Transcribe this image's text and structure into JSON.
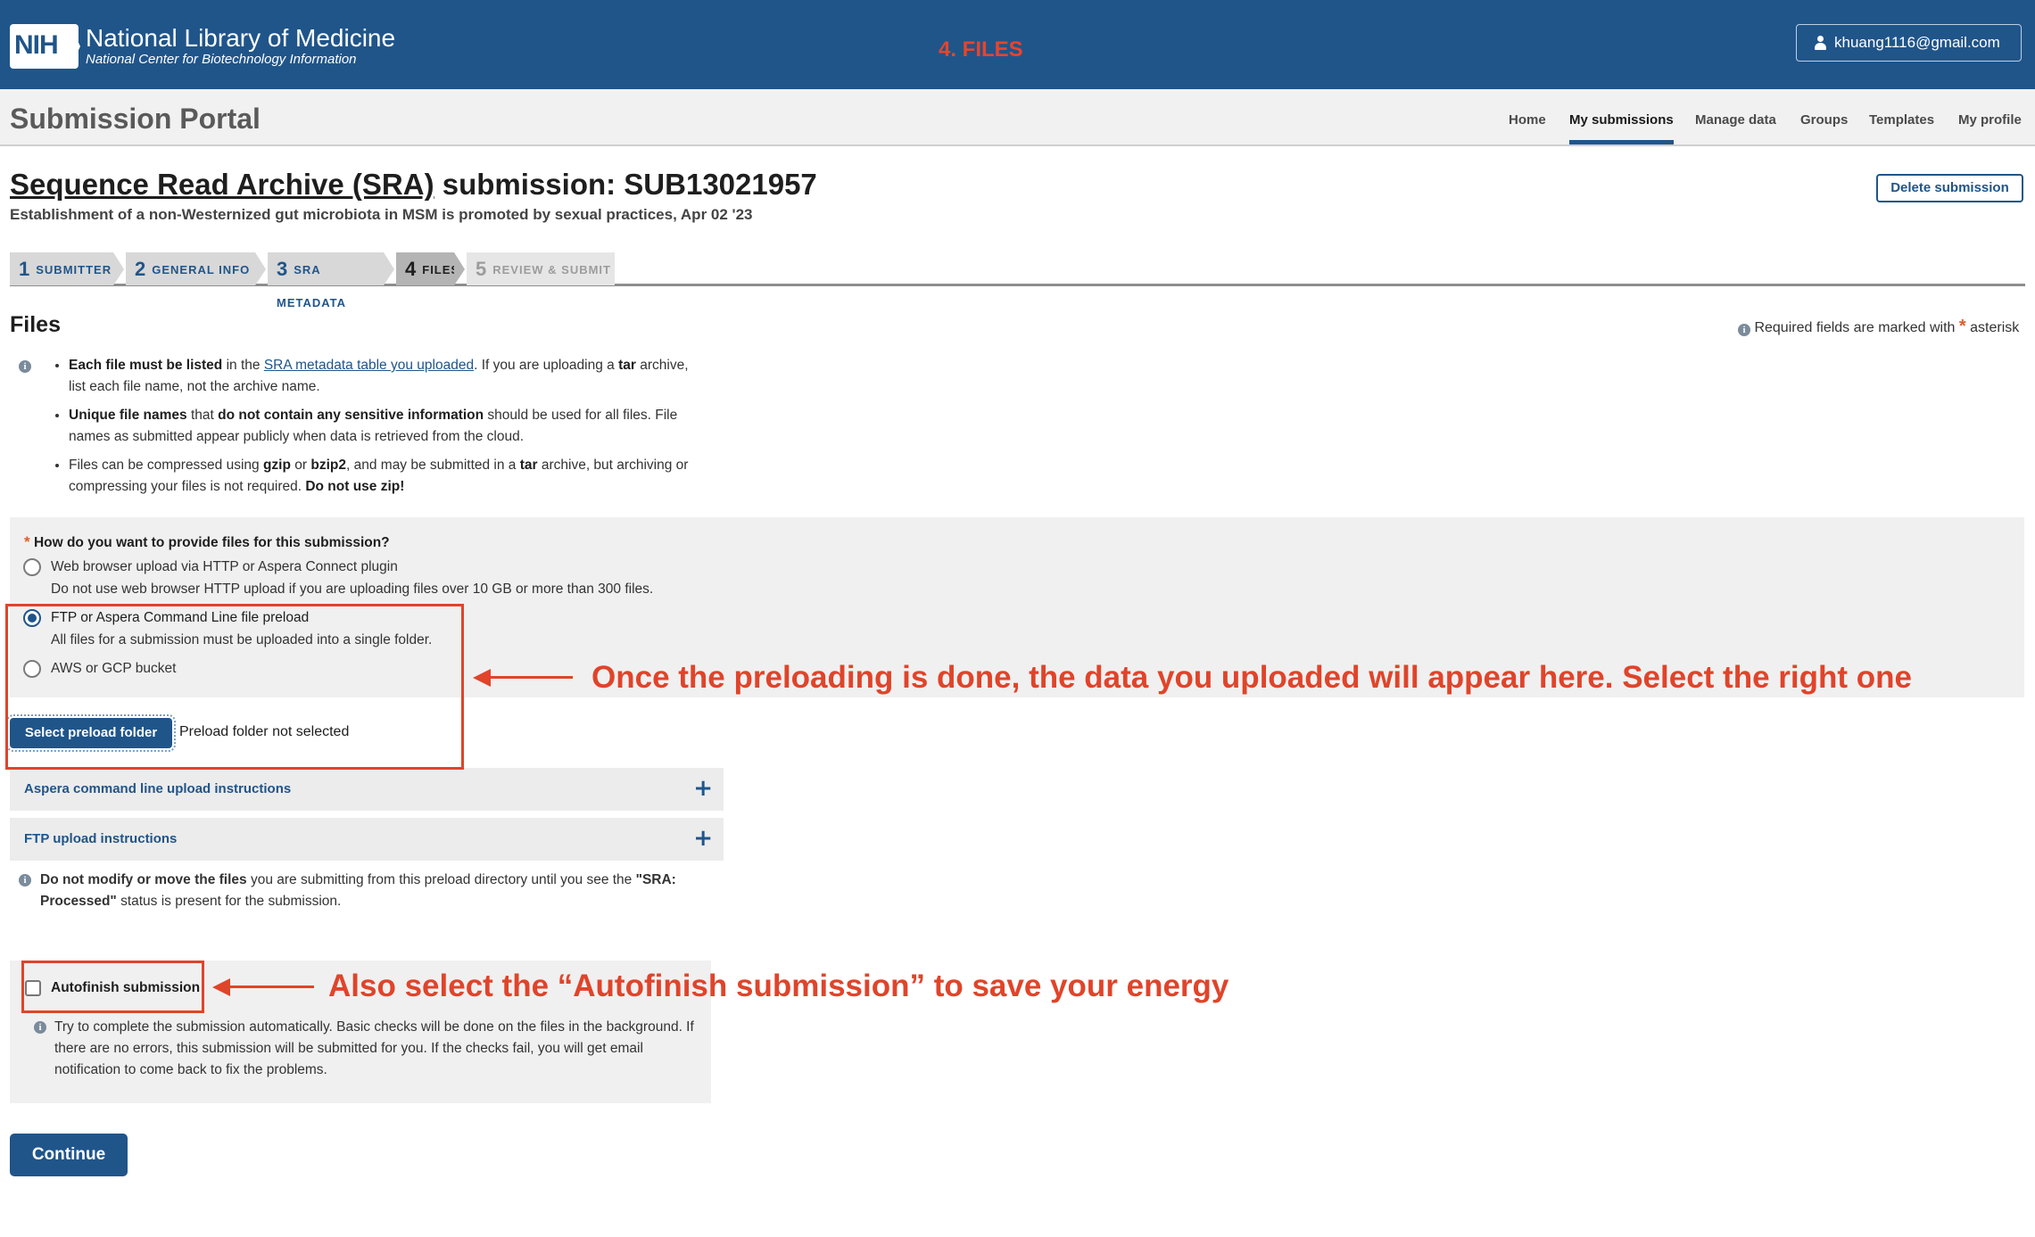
{
  "header": {
    "logo_text": "NIH",
    "org_name": "National Library of Medicine",
    "org_sub": "National Center for Biotechnology Information",
    "step_title": "4. FILES",
    "account_email": "khuang1116@gmail.com"
  },
  "nav": {
    "portal_title": "Submission Portal",
    "items": [
      "Home",
      "My submissions",
      "Manage data",
      "Groups",
      "Templates",
      "My profile"
    ],
    "active": "My submissions"
  },
  "submission": {
    "title_link": "Sequence Read Archive (SRA)",
    "title_rest": " submission: SUB13021957",
    "subtitle": "Establishment of a non-Westernized gut microbiota in MSM is promoted by sexual practices, Apr 02 '23",
    "delete_label": "Delete submission"
  },
  "steps": [
    {
      "num": "1",
      "label": "SUBMITTER"
    },
    {
      "num": "2",
      "label": "GENERAL INFO"
    },
    {
      "num": "3",
      "label": "SRA METADATA"
    },
    {
      "num": "4",
      "label": "FILES"
    },
    {
      "num": "5",
      "label": "REVIEW & SUBMIT"
    }
  ],
  "files": {
    "heading": "Files",
    "required_note_prefix": "Required fields are marked with",
    "required_note_suffix": "asterisk",
    "bullets": {
      "b1_bold": "Each file must be listed",
      "b1_text1": " in the ",
      "b1_link": "SRA metadata table you uploaded",
      "b1_text2": ". If you are uploading a ",
      "b1_bold2": "tar",
      "b1_text3": " archive, list each file name, not the archive name.",
      "b2_bold": "Unique file names",
      "b2_text1": " that ",
      "b2_bold2": "do not contain any sensitive information",
      "b2_text2": " should be used for all files. File names as submitted appear publicly when data is retrieved from the cloud.",
      "b3_text1": "Files can be compressed using ",
      "b3_bold1": "gzip",
      "b3_text2": " or ",
      "b3_bold2": "bzip2",
      "b3_text3": ", and may be submitted in a ",
      "b3_bold3": "tar",
      "b3_text4": " archive, but archiving or compressing your files is not required. ",
      "b3_bold4": "Do not use zip!"
    },
    "question": "How do you want to provide files for this submission?",
    "options": [
      {
        "label": "Web browser upload via HTTP or Aspera Connect plugin",
        "hint": "Do not use web browser HTTP upload if you are uploading files over 10 GB or more than 300 files."
      },
      {
        "label": "FTP or Aspera Command Line file preload",
        "hint": "All files for a submission must be uploaded into a single folder."
      },
      {
        "label": "AWS or GCP bucket",
        "hint": ""
      }
    ],
    "selected_option": 1,
    "preload_button": "Select preload folder",
    "preload_status": "Preload folder not selected",
    "accordions": [
      "Aspera command line upload instructions",
      "FTP upload instructions"
    ],
    "warning_bold": "Do not modify or move the files",
    "warning_text1": " you are submitting from this preload directory until you see the ",
    "warning_bold2": "\"SRA: Processed\"",
    "warning_text2": " status is present for the submission.",
    "autofinish_label": "Autofinish submission",
    "autofinish_checked": false,
    "autofinish_help": "Try to complete the submission automatically. Basic checks will be done on the files in the background. If there are no errors, this submission will be submitted for you. If the checks fail, you will get email notification to come back to fix the problems.",
    "continue_label": "Continue"
  },
  "annotations": {
    "preload_note": "Once the preloading is done, the data you uploaded will appear here. Select the right one",
    "autofinish_note": "Also select the “Autofinish submission” to save your energy",
    "color": "#e0442a"
  },
  "colors": {
    "brand": "#20558a",
    "accent_red": "#e8442c"
  }
}
